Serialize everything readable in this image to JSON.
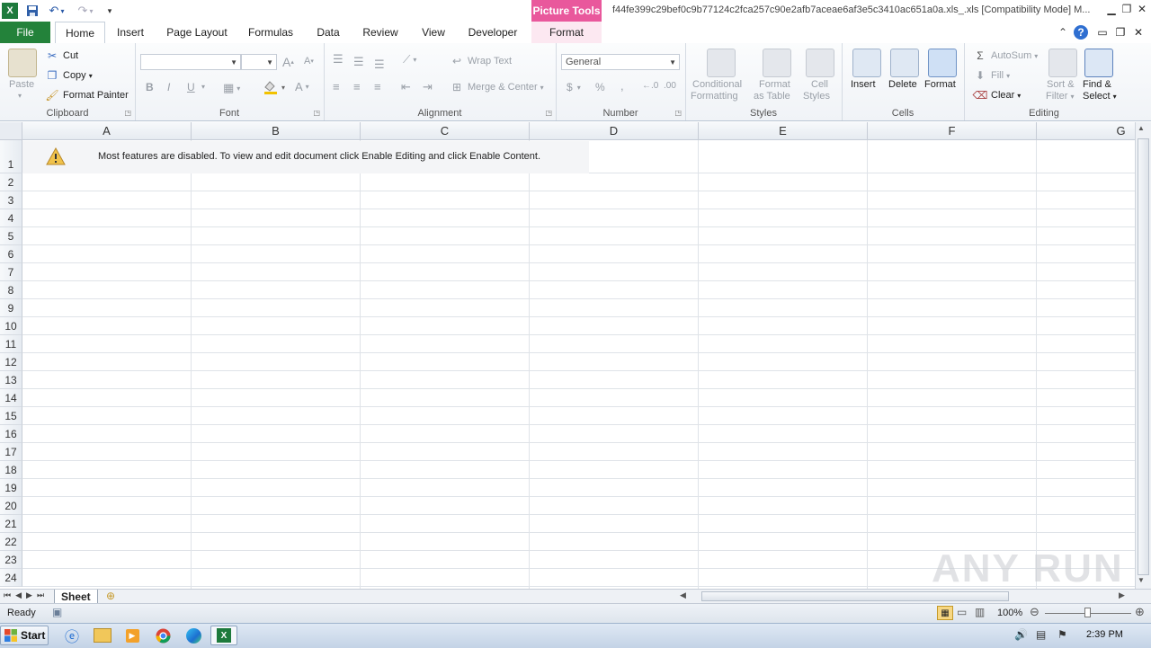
{
  "window": {
    "title": "f44fe399c29bef0c9b77124c2fca257c90e2afb7aceae6af3e5c3410ac651a0a.xls_.xls  [Compatibility Mode] M...",
    "contextual_group": "Picture Tools"
  },
  "tabs": [
    "File",
    "Home",
    "Insert",
    "Page Layout",
    "Formulas",
    "Data",
    "Review",
    "View",
    "Developer",
    "Format"
  ],
  "ribbon": {
    "clipboard": {
      "label": "Clipboard",
      "paste": "Paste",
      "cut": "Cut",
      "copy": "Copy",
      "format_painter": "Format Painter"
    },
    "font": {
      "label": "Font",
      "font_name": "",
      "font_size": "",
      "bold": "B",
      "italic": "I",
      "underline": "U"
    },
    "alignment": {
      "label": "Alignment",
      "wrap_text": "Wrap Text",
      "merge_center": "Merge & Center"
    },
    "number": {
      "label": "Number",
      "format": "General",
      "currency": "$",
      "percent": "%",
      "comma": ","
    },
    "styles": {
      "label": "Styles",
      "conditional_1": "Conditional",
      "conditional_2": "Formatting",
      "table_1": "Format",
      "table_2": "as Table",
      "cell_1": "Cell",
      "cell_2": "Styles"
    },
    "cells": {
      "label": "Cells",
      "insert": "Insert",
      "delete": "Delete",
      "format": "Format"
    },
    "editing": {
      "label": "Editing",
      "autosum": "AutoSum",
      "fill": "Fill",
      "clear": "Clear",
      "sort_1": "Sort &",
      "sort_2": "Filter",
      "find_1": "Find &",
      "find_2": "Select"
    }
  },
  "sheet": {
    "columns": [
      "A",
      "B",
      "C",
      "D",
      "E",
      "F",
      "G"
    ],
    "rows": [
      "1",
      "2",
      "3",
      "4",
      "5",
      "6",
      "7",
      "8",
      "9",
      "10",
      "11",
      "12",
      "13",
      "14",
      "15",
      "16",
      "17",
      "18",
      "19",
      "20",
      "21",
      "22",
      "23",
      "24"
    ],
    "message": "Most features are disabled. To view and edit document click Enable Editing and click Enable Content.",
    "tab_name": "Sheet"
  },
  "status": {
    "ready": "Ready",
    "zoom": "100%"
  },
  "taskbar": {
    "start": "Start",
    "time": "2:39 PM"
  },
  "watermark": "ANY RUN",
  "colors": {
    "file_tab": "#23823a",
    "picture_tools": "#e9589c",
    "excel_green": "#1e7a3c"
  }
}
